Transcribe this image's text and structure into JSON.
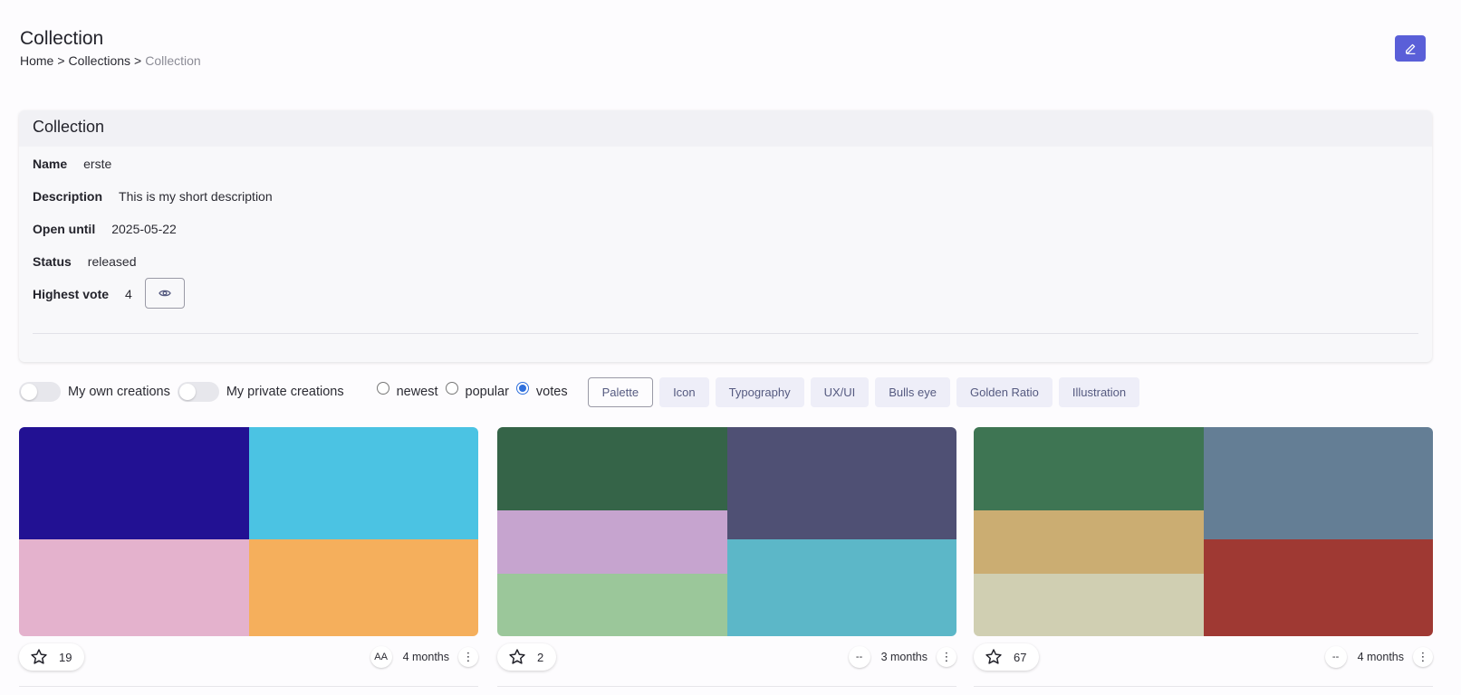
{
  "header": {
    "title": "Collection",
    "breadcrumb": {
      "home": "Home",
      "sep1": ">",
      "collections": "Collections",
      "sep2": ">",
      "current": "Collection"
    },
    "edit_icon": "pencil-icon"
  },
  "card": {
    "title": "Collection",
    "fields": {
      "name": {
        "label": "Name",
        "value": "erste"
      },
      "description": {
        "label": "Description",
        "value": "This is my short description"
      },
      "open_until": {
        "label": "Open until",
        "value": "2025-05-22"
      },
      "status": {
        "label": "Status",
        "value": "released"
      },
      "highest_vote": {
        "label": "Highest vote",
        "value": "4",
        "icon": "eye-icon"
      }
    }
  },
  "filters": {
    "toggles": [
      {
        "label": "My own creations",
        "on": false
      },
      {
        "label": "My private creations",
        "on": false
      }
    ],
    "sort": {
      "options": [
        "newest",
        "popular",
        "votes"
      ],
      "selected": "votes"
    },
    "categories": [
      "Palette",
      "Icon",
      "Typography",
      "UX/UI",
      "Bulls eye",
      "Golden Ratio",
      "Illustration"
    ],
    "active_category": "Palette"
  },
  "creations": [
    {
      "votes": "19",
      "author": "AA",
      "time": "4 months",
      "colors": [
        "#221193",
        "#4bc3e3",
        "#e4b2cd",
        "#f5af5c"
      ]
    },
    {
      "votes": "2",
      "author": "--",
      "time": "3 months",
      "colors": [
        "#356448",
        "#4f5074",
        "#c6a4cf",
        "#9bc79a",
        "#5cb7c8"
      ]
    },
    {
      "votes": "67",
      "author": "--",
      "time": "4 months",
      "colors": [
        "#3e7553",
        "#647e95",
        "#cbad72",
        "#d0cfb2",
        "#9f3933"
      ]
    }
  ],
  "colors": {
    "accent": "#5a5fd8",
    "radio": "#2f6fdc"
  }
}
